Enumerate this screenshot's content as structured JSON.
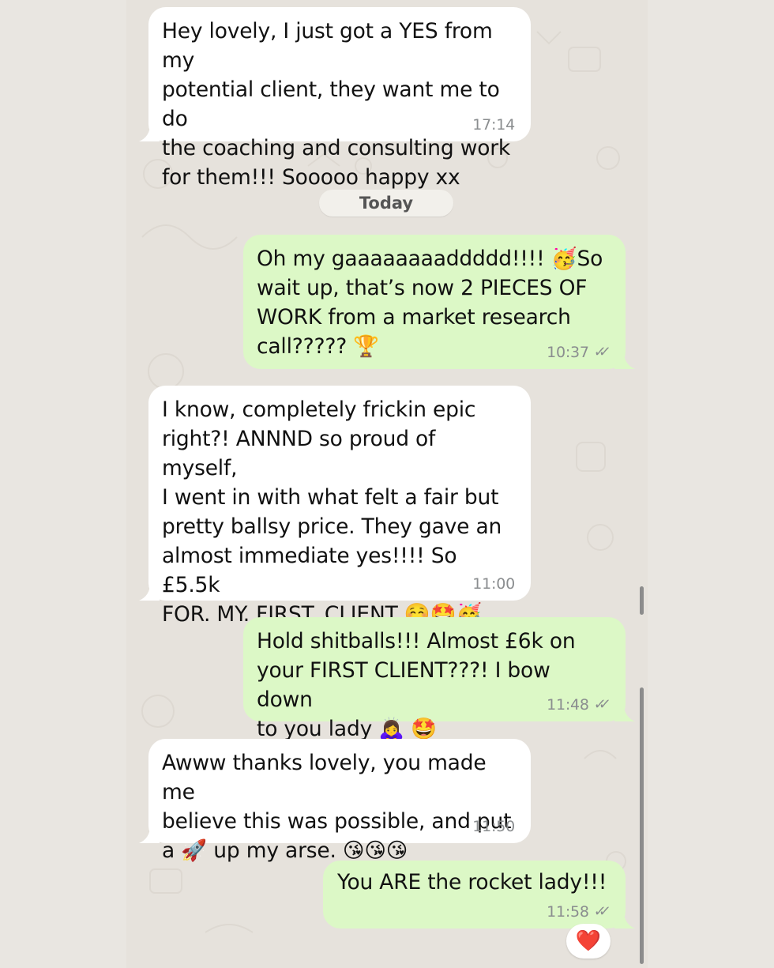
{
  "chat": {
    "date_separator": "Today",
    "messages": [
      {
        "direction": "incoming",
        "text": "Hey lovely, I just got a YES from my\npotential client, they want me to do\nthe coaching and consulting work\nfor them!!! Sooooo happy xx",
        "time": "17:14"
      },
      {
        "direction": "outgoing",
        "text": "Oh my gaaaaaaaaddddd!!!! 🥳So\nwait up, that’s now 2 PIECES OF\nWORK from a market research\ncall????? 🏆",
        "time": "10:37",
        "status": "read"
      },
      {
        "direction": "incoming",
        "text": "I know, completely frickin epic\nright?! ANNND so proud of myself,\nI went in with what felt a fair but\npretty ballsy price. They gave an\nalmost immediate yes!!!! So £5.5k\nFOR. MY. FIRST. CLIENT ☺️🤩🥳",
        "time": "11:00"
      },
      {
        "direction": "outgoing",
        "text": "Hold shitballs!!! Almost £6k on\nyour FIRST CLIENT???! I bow down\nto you lady 🙇‍♀️ 🤩",
        "time": "11:48",
        "status": "read"
      },
      {
        "direction": "incoming",
        "text": "Awww thanks lovely, you made me\nbelieve this was possible, and put\na 🚀 up my arse. 😘😘😘",
        "time": "11:50"
      },
      {
        "direction": "outgoing",
        "text": "You ARE the rocket lady!!!",
        "time": "11:58",
        "status": "read",
        "reaction": "❤️"
      }
    ]
  },
  "icons": {
    "read_receipt": "double-check-icon",
    "reaction": "heart-icon"
  },
  "colors": {
    "incoming_bubble": "#ffffff",
    "outgoing_bubble": "#dcf8c6",
    "chat_background": "#e6e2dc",
    "timestamp": "#8a8d8f",
    "reaction_heart": "#e0252f"
  }
}
